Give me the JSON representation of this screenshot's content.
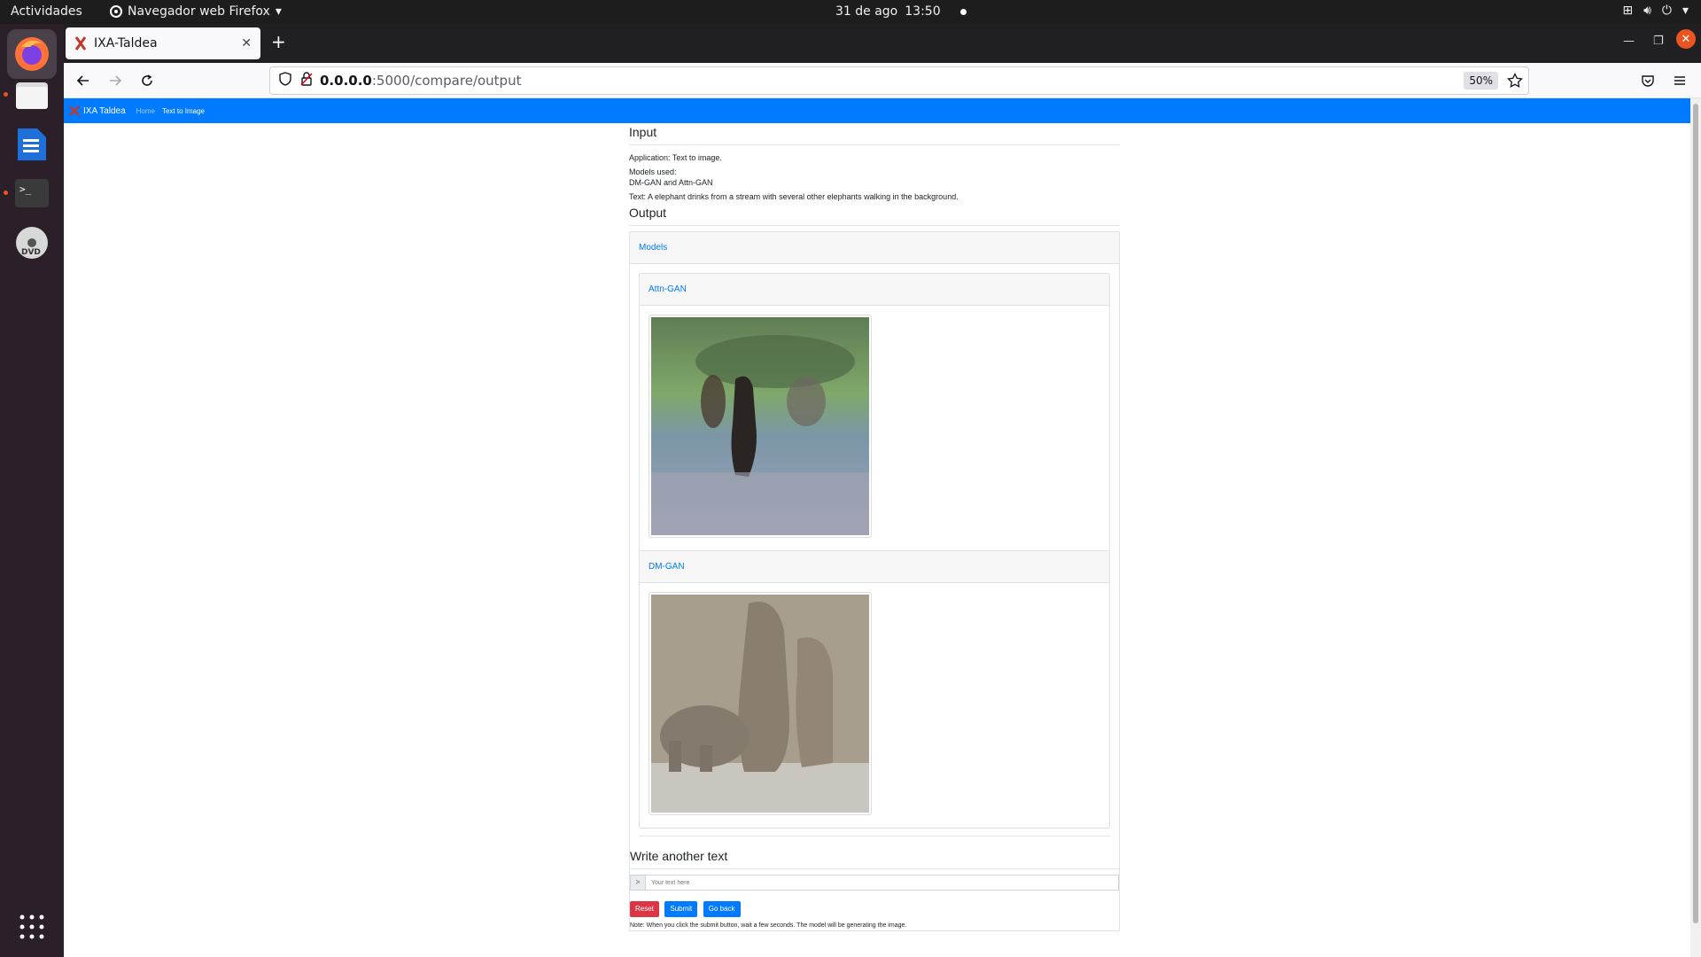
{
  "system": {
    "activities": "Actividades",
    "app_name": "Navegador web Firefox",
    "date": "31 de ago",
    "time": "13:50"
  },
  "browser": {
    "tab_title": "IXA-Taldea",
    "url_host": "0.0.0.0",
    "url_path": ":5000/compare/output",
    "zoom": "50%"
  },
  "site": {
    "brand": "IXA Taldea",
    "nav_home": "Home",
    "nav_text_to_image": "Text to Image"
  },
  "input": {
    "heading": "Input",
    "application": "Application: Text to image.",
    "models_used_label": "Models used:",
    "models_used_value": "DM-GAN and Attn-GAN",
    "text": "Text: A elephant drinks from a stream with several other elephants walking in the background."
  },
  "output": {
    "heading": "Output",
    "models_header": "Models",
    "models": [
      {
        "name": "Attn-GAN"
      },
      {
        "name": "DM-GAN"
      }
    ]
  },
  "form": {
    "heading": "Write another text",
    "prefix": ">",
    "placeholder": "Your text here",
    "reset": "Reset",
    "submit": "Submit",
    "goback": "Go back",
    "note": "Note: When you click the submit button, wait a few seconds. The model will be generating the image."
  }
}
